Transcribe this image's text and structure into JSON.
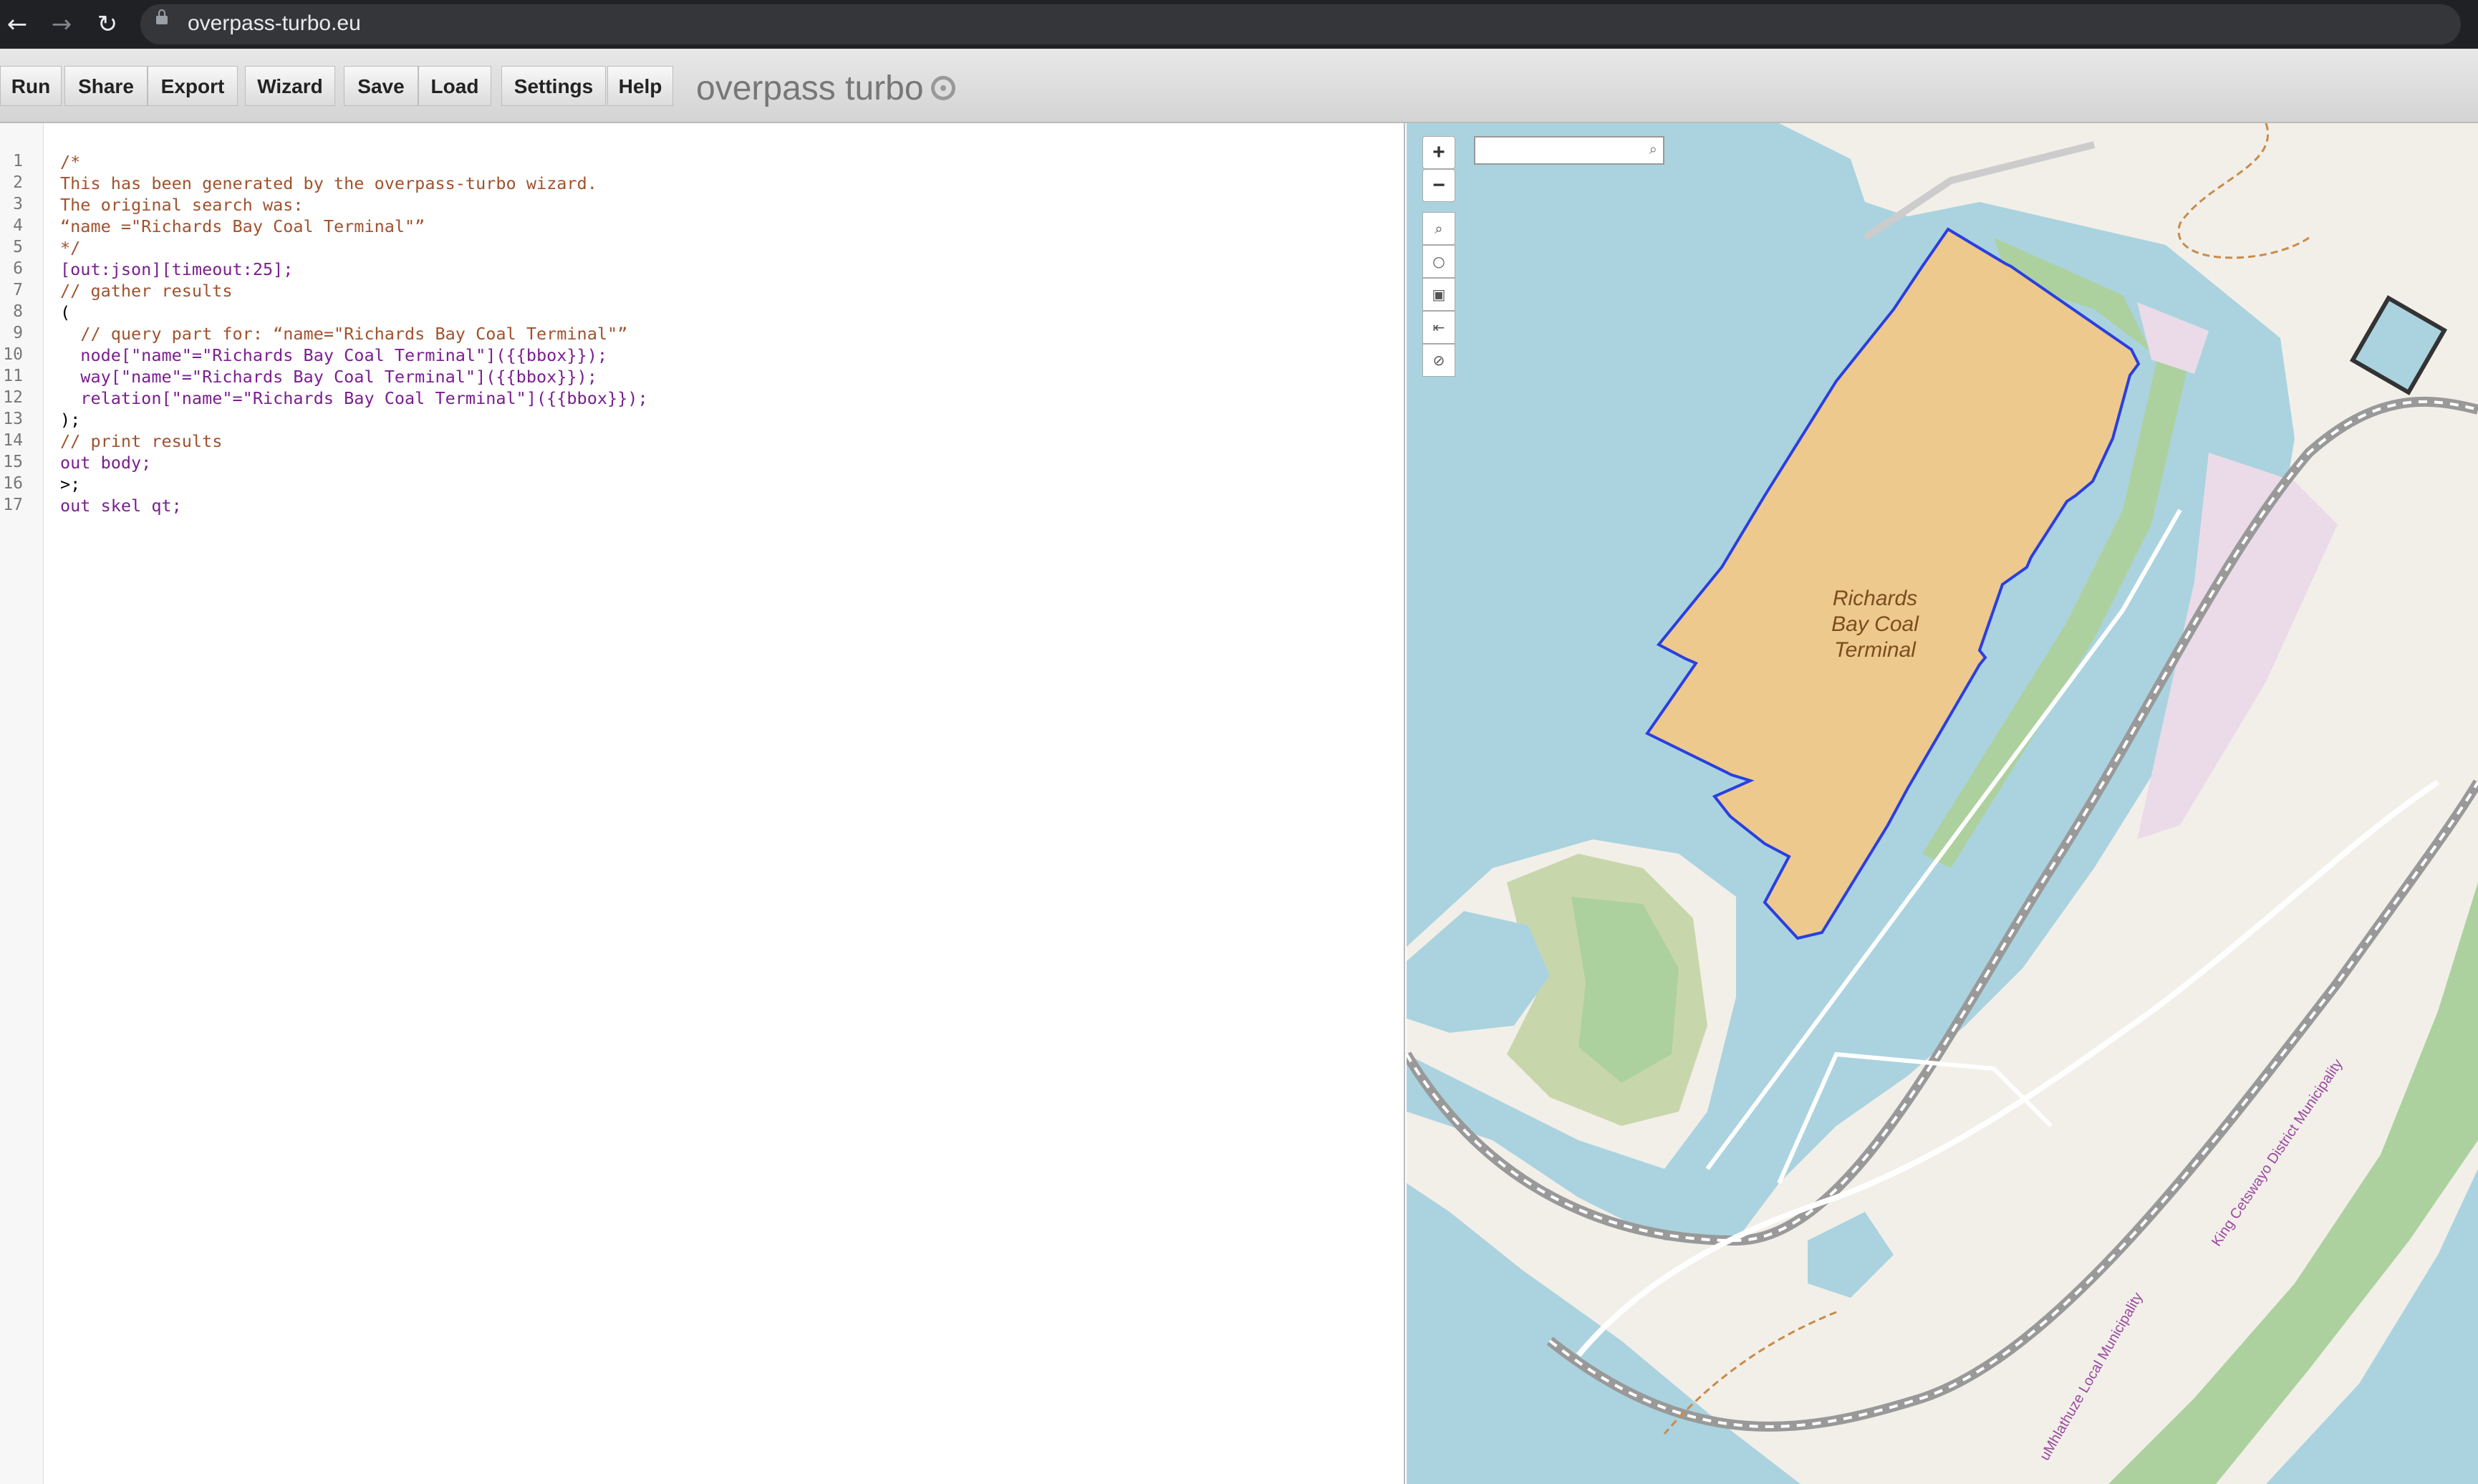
{
  "browser": {
    "url": "overpass-turbo.eu"
  },
  "toolbar": {
    "buttons": [
      "Run",
      "Share",
      "Export",
      "Wizard",
      "Save",
      "Load",
      "Settings",
      "Help"
    ],
    "brand": "overpass turbo"
  },
  "editor": {
    "line_numbers": [
      "1",
      "2",
      "3",
      "4",
      "5",
      "6",
      "7",
      "8",
      "9",
      "10",
      "11",
      "12",
      "13",
      "14",
      "15",
      "16",
      "17"
    ],
    "lines": [
      "/*",
      "This has been generated by the overpass-turbo wizard.",
      "The original search was:",
      "“name =\"Richards Bay Coal Terminal\"”",
      "*/",
      "[out:json][timeout:25];",
      "// gather results",
      "(",
      "  // query part for: “name=\"Richards Bay Coal Terminal\"”",
      "  node[\"name\"=\"Richards Bay Coal Terminal\"]({{bbox}});",
      "  way[\"name\"=\"Richards Bay Coal Terminal\"]({{bbox}});",
      "  relation[\"name\"=\"Richards Bay Coal Terminal\"]({{bbox}});",
      ");",
      "// print results",
      "out body;",
      ">;",
      "out skel qt;"
    ]
  },
  "map": {
    "zoom_in": "+",
    "zoom_out": "−",
    "search_placeholder": "",
    "feature_label": [
      "Richards",
      "Bay Coal",
      "Terminal"
    ],
    "municipality_labels": [
      "King Cetswayo District Municipality",
      "uMhlathuze Local Municipality"
    ],
    "colors": {
      "water": "#aad3df",
      "land": "#f2efe9",
      "forest": "#add19e",
      "wetland": "#c8d7ab",
      "industrial": "#ebdbe8",
      "highlight_fill": "#f0c888",
      "highlight_stroke": "#2a3fe0"
    }
  }
}
